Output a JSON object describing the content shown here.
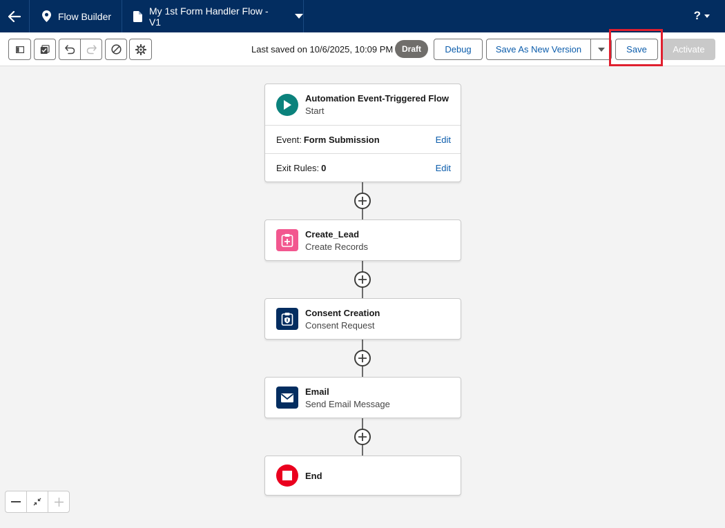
{
  "topbar": {
    "app_name": "Flow Builder",
    "flow_name": "My 1st Form Handler Flow - V1",
    "help_label": "?"
  },
  "toolbar": {
    "last_saved": "Last saved on 10/6/2025, 10:09 PM",
    "status_badge": "Draft",
    "debug_label": "Debug",
    "save_as_new_label": "Save As New Version",
    "save_label": "Save",
    "activate_label": "Activate"
  },
  "nodes": {
    "start": {
      "title": "Automation Event-Triggered Flow",
      "subtitle": "Start",
      "event_label": "Event:",
      "event_value": "Form Submission",
      "exit_label": "Exit Rules:",
      "exit_value": "0",
      "edit_label": "Edit"
    },
    "create_lead": {
      "title": "Create_Lead",
      "subtitle": "Create Records"
    },
    "consent": {
      "title": "Consent Creation",
      "subtitle": "Consent Request"
    },
    "email": {
      "title": "Email",
      "subtitle": "Send Email Message"
    },
    "end": {
      "title": "End"
    }
  },
  "colors": {
    "navy": "#032d60",
    "start_icon": "#0b827c",
    "create_icon": "#f2578f",
    "consent_icon": "#032d60",
    "email_icon": "#032d60",
    "end_icon": "#ea001e",
    "link": "#0b5cab",
    "highlight": "#e0202f"
  },
  "icons": {
    "back": "arrow-left-icon",
    "app": "location-pin-icon",
    "flow": "document-icon",
    "toggle_panel": "panel-icon",
    "check": "checklist-icon",
    "undo": "undo-icon",
    "redo": "redo-icon",
    "errors": "ban-icon",
    "settings": "gear-icon"
  }
}
